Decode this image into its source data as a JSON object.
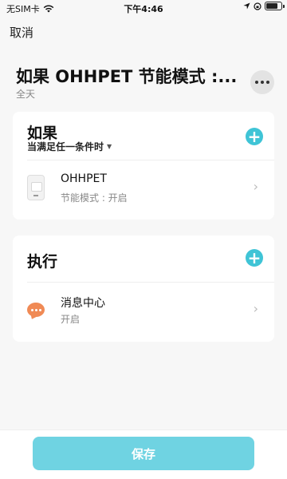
{
  "status_bar": {
    "carrier": "无SIM卡",
    "time": "下午4:46",
    "battery_level": 0.8
  },
  "nav": {
    "cancel_label": "取消"
  },
  "scene": {
    "title": "如果 OHHPET 节能模式 :...",
    "subtitle": "全天"
  },
  "if_section": {
    "heading": "如果",
    "condition_mode": "当满足任一条件时",
    "items": [
      {
        "name": "OHHPET",
        "detail": "节能模式 : 开启",
        "icon": "pet-feeder-icon"
      }
    ]
  },
  "exec_section": {
    "heading": "执行",
    "items": [
      {
        "name": "消息中心",
        "detail": "开启",
        "icon": "message-center-icon"
      }
    ]
  },
  "footer": {
    "save_label": "保存"
  },
  "colors": {
    "accent": "#3fc4d6",
    "save_button": "#6fd3e2",
    "message_icon": "#f08a55"
  }
}
